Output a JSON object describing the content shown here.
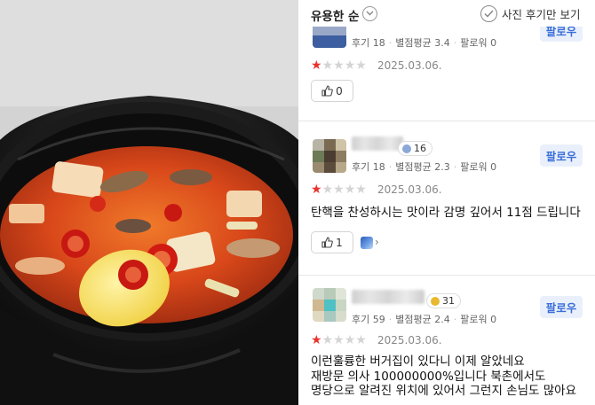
{
  "photo": {
    "alt": "kimchi stew in a black clay pot",
    "colors": {
      "broth": "#d9481a",
      "pot": "#1d1d1d",
      "backdrop": "#d4d4d4"
    }
  },
  "sortbar": {
    "sort_label": "유용한 순",
    "photo_only_label": "사진 후기만 보기"
  },
  "reviews": [
    {
      "stats": {
        "reviews": "후기 18",
        "avg": "별점평균 3.4",
        "followers": "팔로워 0"
      },
      "follow_label": "팔로우",
      "rating": 1,
      "date": "2025.03.06.",
      "like_count": "0"
    },
    {
      "level": "16",
      "stats": {
        "reviews": "후기 18",
        "avg": "별점평균 2.3",
        "followers": "팔로워 0"
      },
      "follow_label": "팔로우",
      "rating": 1,
      "date": "2025.03.06.",
      "text": [
        "탄핵을 찬성하시는 맛이라 감명 깊어서 11점 드립니다"
      ],
      "like_count": "1",
      "more_arrow": "›"
    },
    {
      "level": "31",
      "stats": {
        "reviews": "후기 59",
        "avg": "별점평균 2.4",
        "followers": "팔로워 0"
      },
      "follow_label": "팔로우",
      "rating": 1,
      "date": "2025.03.06.",
      "text": [
        "이런훌륭한 버거집이 있다니 이제 알았네요",
        "재방문 의사 100000000%입니다 북촌에서도",
        "명당으로 알려진 위치에 있어서 그런지 손님도 많아요"
      ]
    }
  ],
  "colors": {
    "accent_star": "#e8332b",
    "follow_text": "#3a6fd8",
    "follow_bg": "#eaf0fb"
  }
}
